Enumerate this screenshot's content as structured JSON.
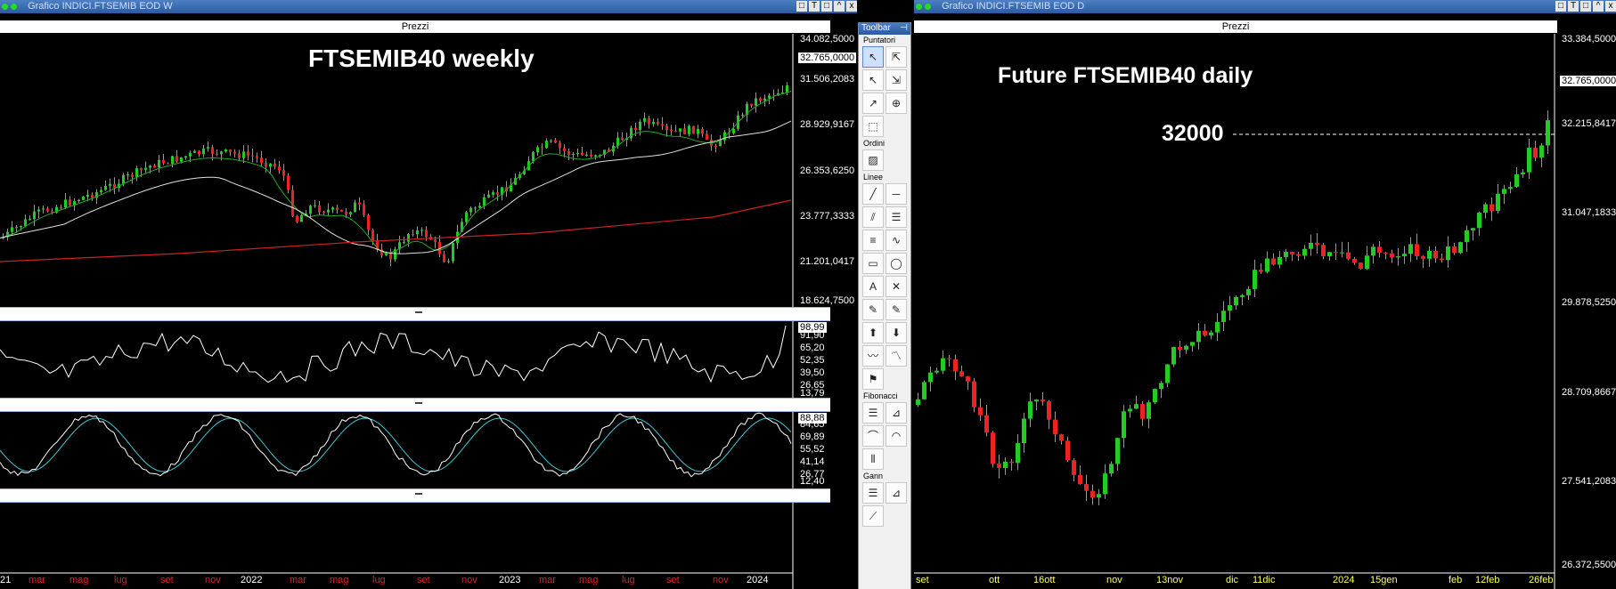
{
  "left_window": {
    "title": "Grafico INDICI.FTSEMIB EOD W",
    "panel_title": "Prezzi",
    "heading": "FTSEMIB40 weekly",
    "price_axis": [
      "34.082,5000",
      "32.765,0000",
      "31.506,2083",
      "28.929,9167",
      "26.353,6250",
      "23.777,3333",
      "21.201,0417",
      "18.624,7500"
    ],
    "rsi_axis": [
      "98,99",
      "91,90",
      "65,20",
      "52,35",
      "39,50",
      "26,65",
      "13,79"
    ],
    "stoch_axis": [
      "88,88",
      "84,65",
      "69,89",
      "55,52",
      "41,14",
      "26,77",
      "12,40"
    ],
    "x_axis": [
      "21",
      "mar",
      "mag",
      "lug",
      "set",
      "nov",
      "2022",
      "mar",
      "mag",
      "lug",
      "set",
      "nov",
      "2023",
      "mar",
      "mag",
      "lug",
      "set",
      "nov",
      "2024"
    ],
    "sep_grip": "..."
  },
  "right_window": {
    "title": "Grafico INDICI.FTSEMIB EOD D",
    "panel_title": "Prezzi",
    "heading": "Future FTSEMIB40 daily",
    "level_label": "32000",
    "price_axis": [
      "33.384,5000",
      "32.765,0000",
      "32.215,8417",
      "31.047,1833",
      "29.878,5250",
      "28.709,8667",
      "27.541,2083",
      "26.372,5500"
    ],
    "x_axis": [
      "set",
      "ott",
      "16ott",
      "nov",
      "13nov",
      "dic",
      "11dic",
      "2024",
      "15gen",
      "feb",
      "12feb",
      "26feb"
    ]
  },
  "title_controls": [
    "□",
    "T",
    "□",
    "^",
    "x"
  ],
  "toolbar": {
    "title": "Toolbar",
    "sections": [
      "Puntatori",
      "Ordini",
      "Linee",
      "Fibonacci",
      "Gann"
    ]
  },
  "colors": {
    "bull": "#22cc22",
    "bear": "#ee2222",
    "ma_fast": "#22aa22",
    "ma_slow": "#e0e0e0",
    "ma_long": "#cc2222",
    "stoch_k": "#ffffff",
    "stoch_d": "#40c8d8",
    "axis_red": "#dd2222",
    "axis_yellow": "#ffff55"
  }
}
